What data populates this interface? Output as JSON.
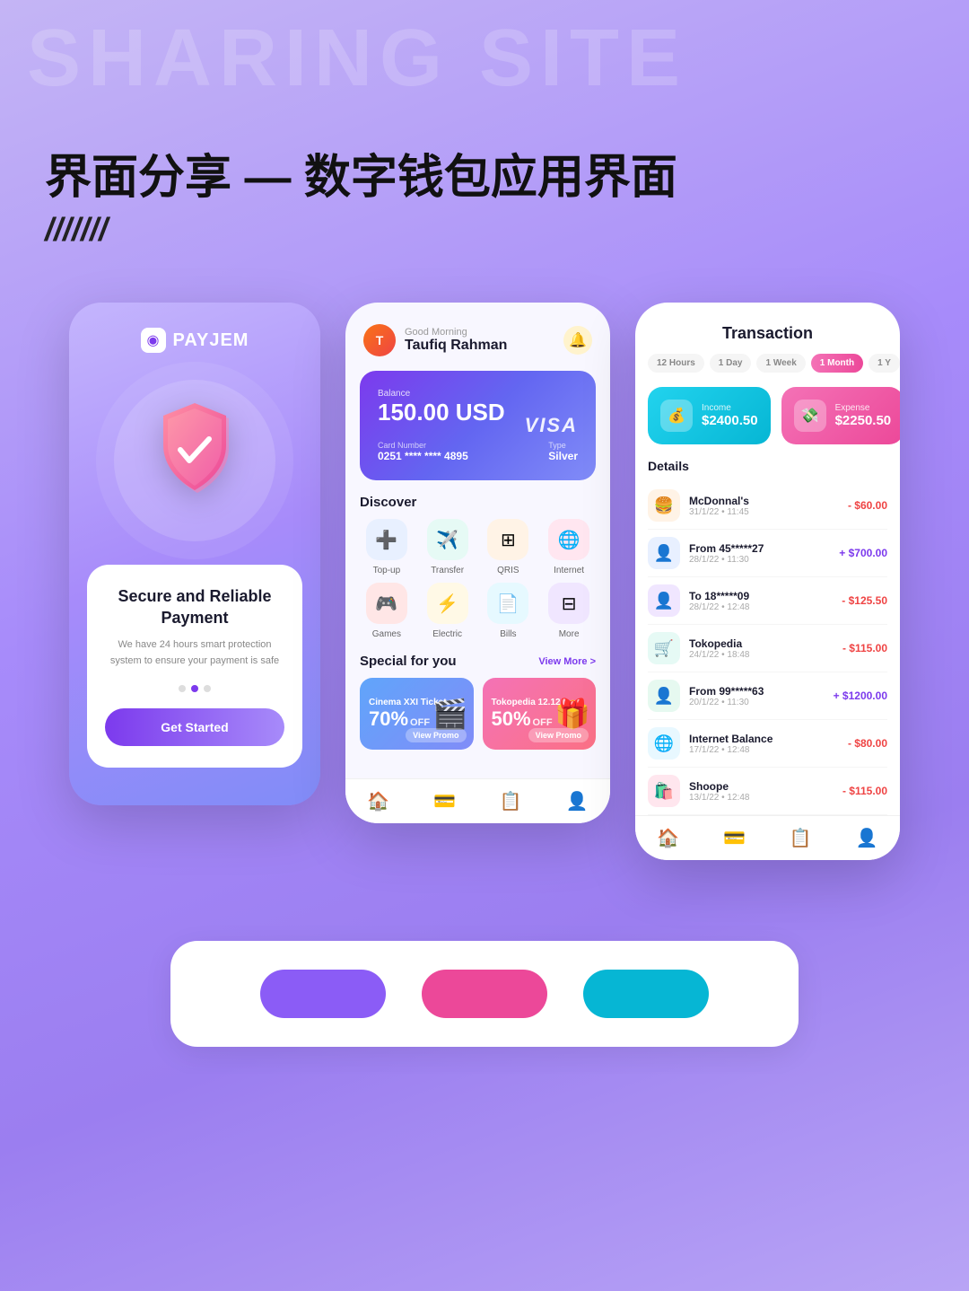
{
  "page": {
    "bg_text": "SHARING SITE",
    "title": "界面分享 — 数字钱包应用界面",
    "slash": "///////"
  },
  "phone1": {
    "logo": "PAYJEM",
    "shield_emoji": "🛡️",
    "card_title": "Secure and Reliable Payment",
    "card_desc": "We have 24 hours smart protection system to ensure your payment is safe",
    "btn_label": "Get Started"
  },
  "phone2": {
    "greeting": "Good Morning",
    "user_name": "Taufiq Rahman",
    "balance_label": "Balance",
    "balance": "150.00 USD",
    "card_brand": "VISA",
    "card_number_label": "Card Number",
    "card_number": "0251 **** **** 4895",
    "card_type_label": "Type",
    "card_type": "Silver",
    "discover_title": "Discover",
    "discover_items": [
      {
        "icon": "➕",
        "label": "Top-up",
        "color": "disc-blue"
      },
      {
        "icon": "✈️",
        "label": "Transfer",
        "color": "disc-teal"
      },
      {
        "icon": "⊞",
        "label": "QRIS",
        "color": "disc-orange"
      },
      {
        "icon": "🌐",
        "label": "Internet",
        "color": "disc-pink"
      },
      {
        "icon": "🎮",
        "label": "Games",
        "color": "disc-red"
      },
      {
        "icon": "⚡",
        "label": "Electric",
        "color": "disc-yellow"
      },
      {
        "icon": "📄",
        "label": "Bills",
        "color": "disc-cyan"
      },
      {
        "icon": "⊟",
        "label": "More",
        "color": "disc-purple"
      }
    ],
    "special_title": "Special for you",
    "view_more": "View More >",
    "promos": [
      {
        "name": "Cinema XXI Ticket",
        "off": "70%",
        "off_label": "OFF",
        "emoji": "🎬",
        "btn": "View Promo"
      },
      {
        "name": "Tokopedia 12.12",
        "off": "50%",
        "off_label": "OFF",
        "emoji": "🎁",
        "btn": "View Promo"
      }
    ]
  },
  "phone3": {
    "title": "Transaction",
    "time_filters": [
      "12 Hours",
      "1 Day",
      "1 Week",
      "1 Month",
      "1 Y"
    ],
    "active_filter": "1 Month",
    "income_label": "Income",
    "income_amount": "$2400.50",
    "expense_label": "Expense",
    "expense_amount": "$2250.50",
    "details_title": "Details",
    "transactions": [
      {
        "icon": "🍔",
        "color": "tx-orange",
        "name": "McDonnal's",
        "date": "31/1/22 • 11:45",
        "amount": "- $60.00",
        "type": "negative"
      },
      {
        "icon": "👤",
        "color": "tx-blue",
        "name": "From 45*****27",
        "date": "28/1/22 • 11:30",
        "amount": "+ $700.00",
        "type": "positive"
      },
      {
        "icon": "👤",
        "color": "tx-purple",
        "name": "To 18*****09",
        "date": "28/1/22 • 12:48",
        "amount": "- $125.50",
        "type": "negative"
      },
      {
        "icon": "🛒",
        "color": "tx-cyan",
        "name": "Tokopedia",
        "date": "24/1/22 • 18:48",
        "amount": "- $115.00",
        "type": "negative"
      },
      {
        "icon": "👤",
        "color": "tx-green",
        "name": "From 99*****63",
        "date": "20/1/22 • 11:30",
        "amount": "+ $1200.00",
        "type": "positive"
      },
      {
        "icon": "🌐",
        "color": "tx-globe",
        "name": "Internet Balance",
        "date": "17/1/22 • 12:48",
        "amount": "- $80.00",
        "type": "negative"
      },
      {
        "icon": "🛍️",
        "color": "tx-shop",
        "name": "Shoope",
        "date": "13/1/22 • 12:48",
        "amount": "- $115.00",
        "type": "negative"
      }
    ]
  },
  "palette": {
    "colors": [
      {
        "label": "purple",
        "class": "pill-purple"
      },
      {
        "label": "pink",
        "class": "pill-pink"
      },
      {
        "label": "teal",
        "class": "pill-teal"
      }
    ]
  }
}
